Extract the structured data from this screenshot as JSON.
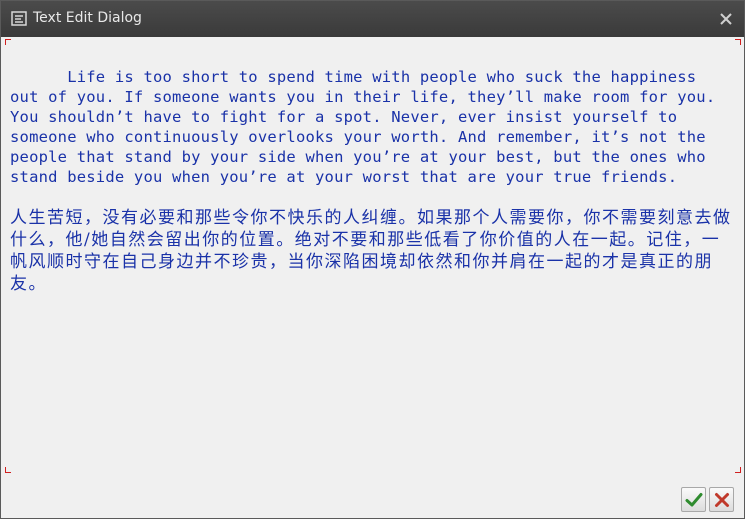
{
  "window": {
    "title": "Text Edit Dialog",
    "title_icon": "text-edit-icon",
    "close_icon": "close-icon"
  },
  "editor": {
    "text_en": "Life is too short to spend time with people who suck the happiness out of you. If someone wants you in their life, they’ll make room for you. You shouldn’t have to fight for a spot. Never, ever insist yourself to someone who continuously overlooks your worth. And remember, it’s not the people that stand by your side when you’re at your best, but the ones who stand beside you when you’re at your worst that are your true friends.",
    "text_zh": "人生苦短，没有必要和那些令你不快乐的人纠缠。如果那个人需要你，你不需要刻意去做什么，他/她自然会留出你的位置。绝对不要和那些低看了你价值的人在一起。记住，一帆风顺时守在自己身边并不珍贵，当你深陷困境却依然和你并肩在一起的才是真正的朋友。",
    "text_color": "#1a32a8"
  },
  "buttons": {
    "ok_icon": "checkmark-icon",
    "cancel_icon": "cancel-x-icon",
    "ok_color": "#2e8b2e",
    "cancel_color": "#c0392b"
  }
}
